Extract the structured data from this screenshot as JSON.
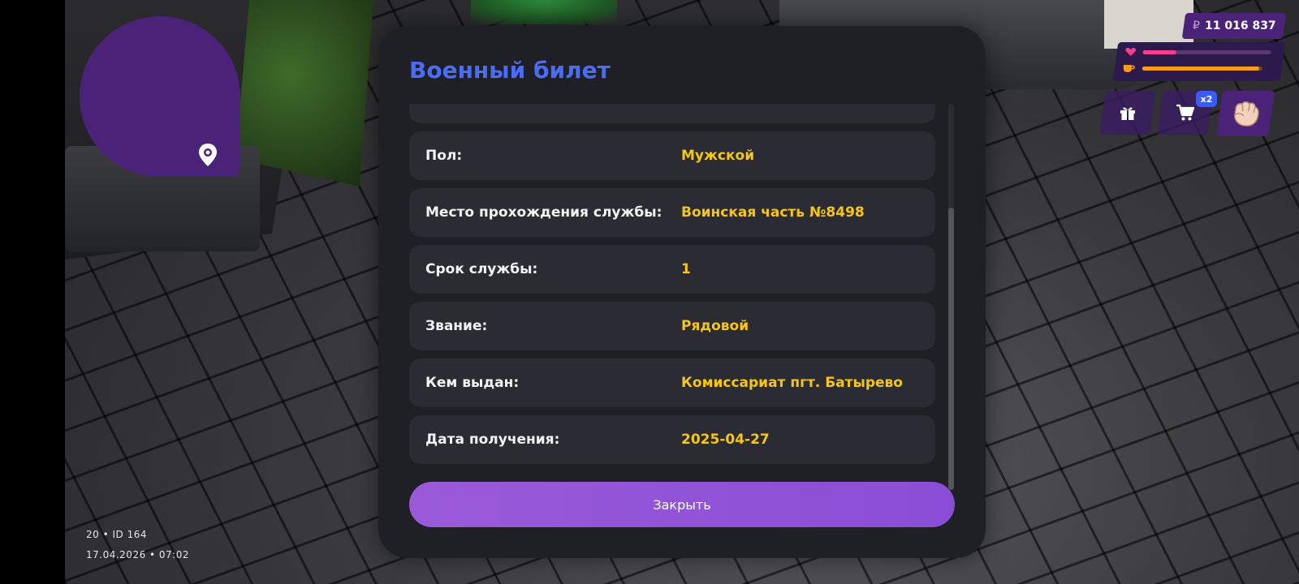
{
  "hud": {
    "money": "11 016 837",
    "currency_symbol": "₽",
    "health_fraction": 0.26,
    "hunger_fraction": 0.97,
    "cart_badge": "x2"
  },
  "footer": {
    "id_line": "20 • ID 164",
    "datetime": "17.04.2026 • 07:02"
  },
  "modal": {
    "title": "Военный билет",
    "rows": [
      {
        "label": "",
        "value": ""
      },
      {
        "label": "Пол:",
        "value": "Мужской"
      },
      {
        "label": "Место прохождения службы:",
        "value": "Воинская часть №8498"
      },
      {
        "label": "Срок службы:",
        "value": "1"
      },
      {
        "label": "Звание:",
        "value": "Рядовой"
      },
      {
        "label": "Кем выдан:",
        "value": "Комиссариат пгт. Батырево"
      },
      {
        "label": "Дата получения:",
        "value": "2025-04-27"
      }
    ],
    "close_label": "Закрыть"
  },
  "colors": {
    "title": "#4a6cf7",
    "value": "#f5c518",
    "accent": "#8a4ed6",
    "hud_purple": "#4a2278"
  },
  "icons": {
    "map_pin": "map-pin-icon",
    "heart": "heart-icon",
    "cup": "cup-icon",
    "gift": "gift-icon",
    "cart": "cart-icon",
    "fist": "fist-icon"
  }
}
